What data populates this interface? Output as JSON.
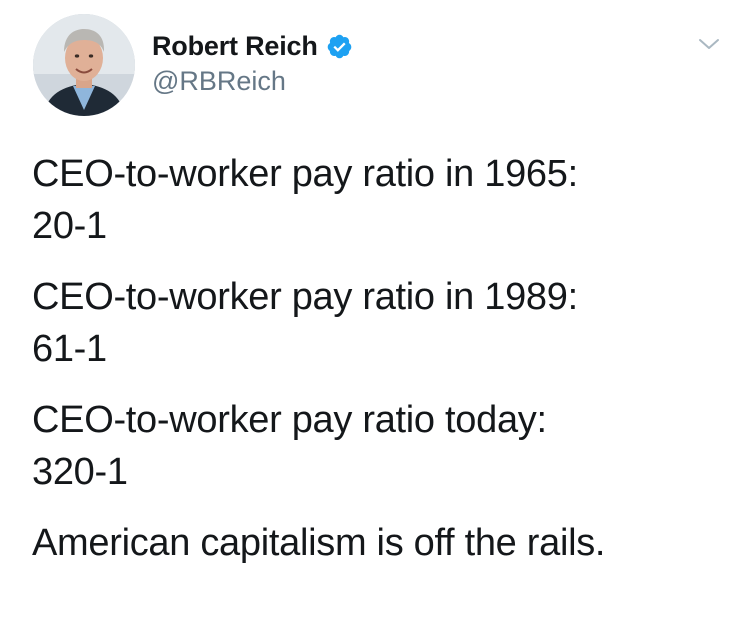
{
  "tweet": {
    "author": {
      "display_name": "Robert Reich",
      "handle": "@RBReich",
      "verified": true
    },
    "icons": {
      "verified": "verified-badge-icon",
      "more": "chevron-down-icon"
    },
    "colors": {
      "verified_badge": "#1da1f2",
      "handle": "#657786",
      "text": "#14171a"
    },
    "paragraphs": [
      {
        "lines": [
          "CEO-to-worker pay ratio in 1965:",
          "20-1"
        ]
      },
      {
        "lines": [
          "CEO-to-worker pay ratio in 1989:",
          "61-1"
        ]
      },
      {
        "lines": [
          "CEO-to-worker pay ratio today:",
          "320-1"
        ]
      },
      {
        "lines": [
          "American capitalism is off the rails."
        ]
      }
    ]
  }
}
